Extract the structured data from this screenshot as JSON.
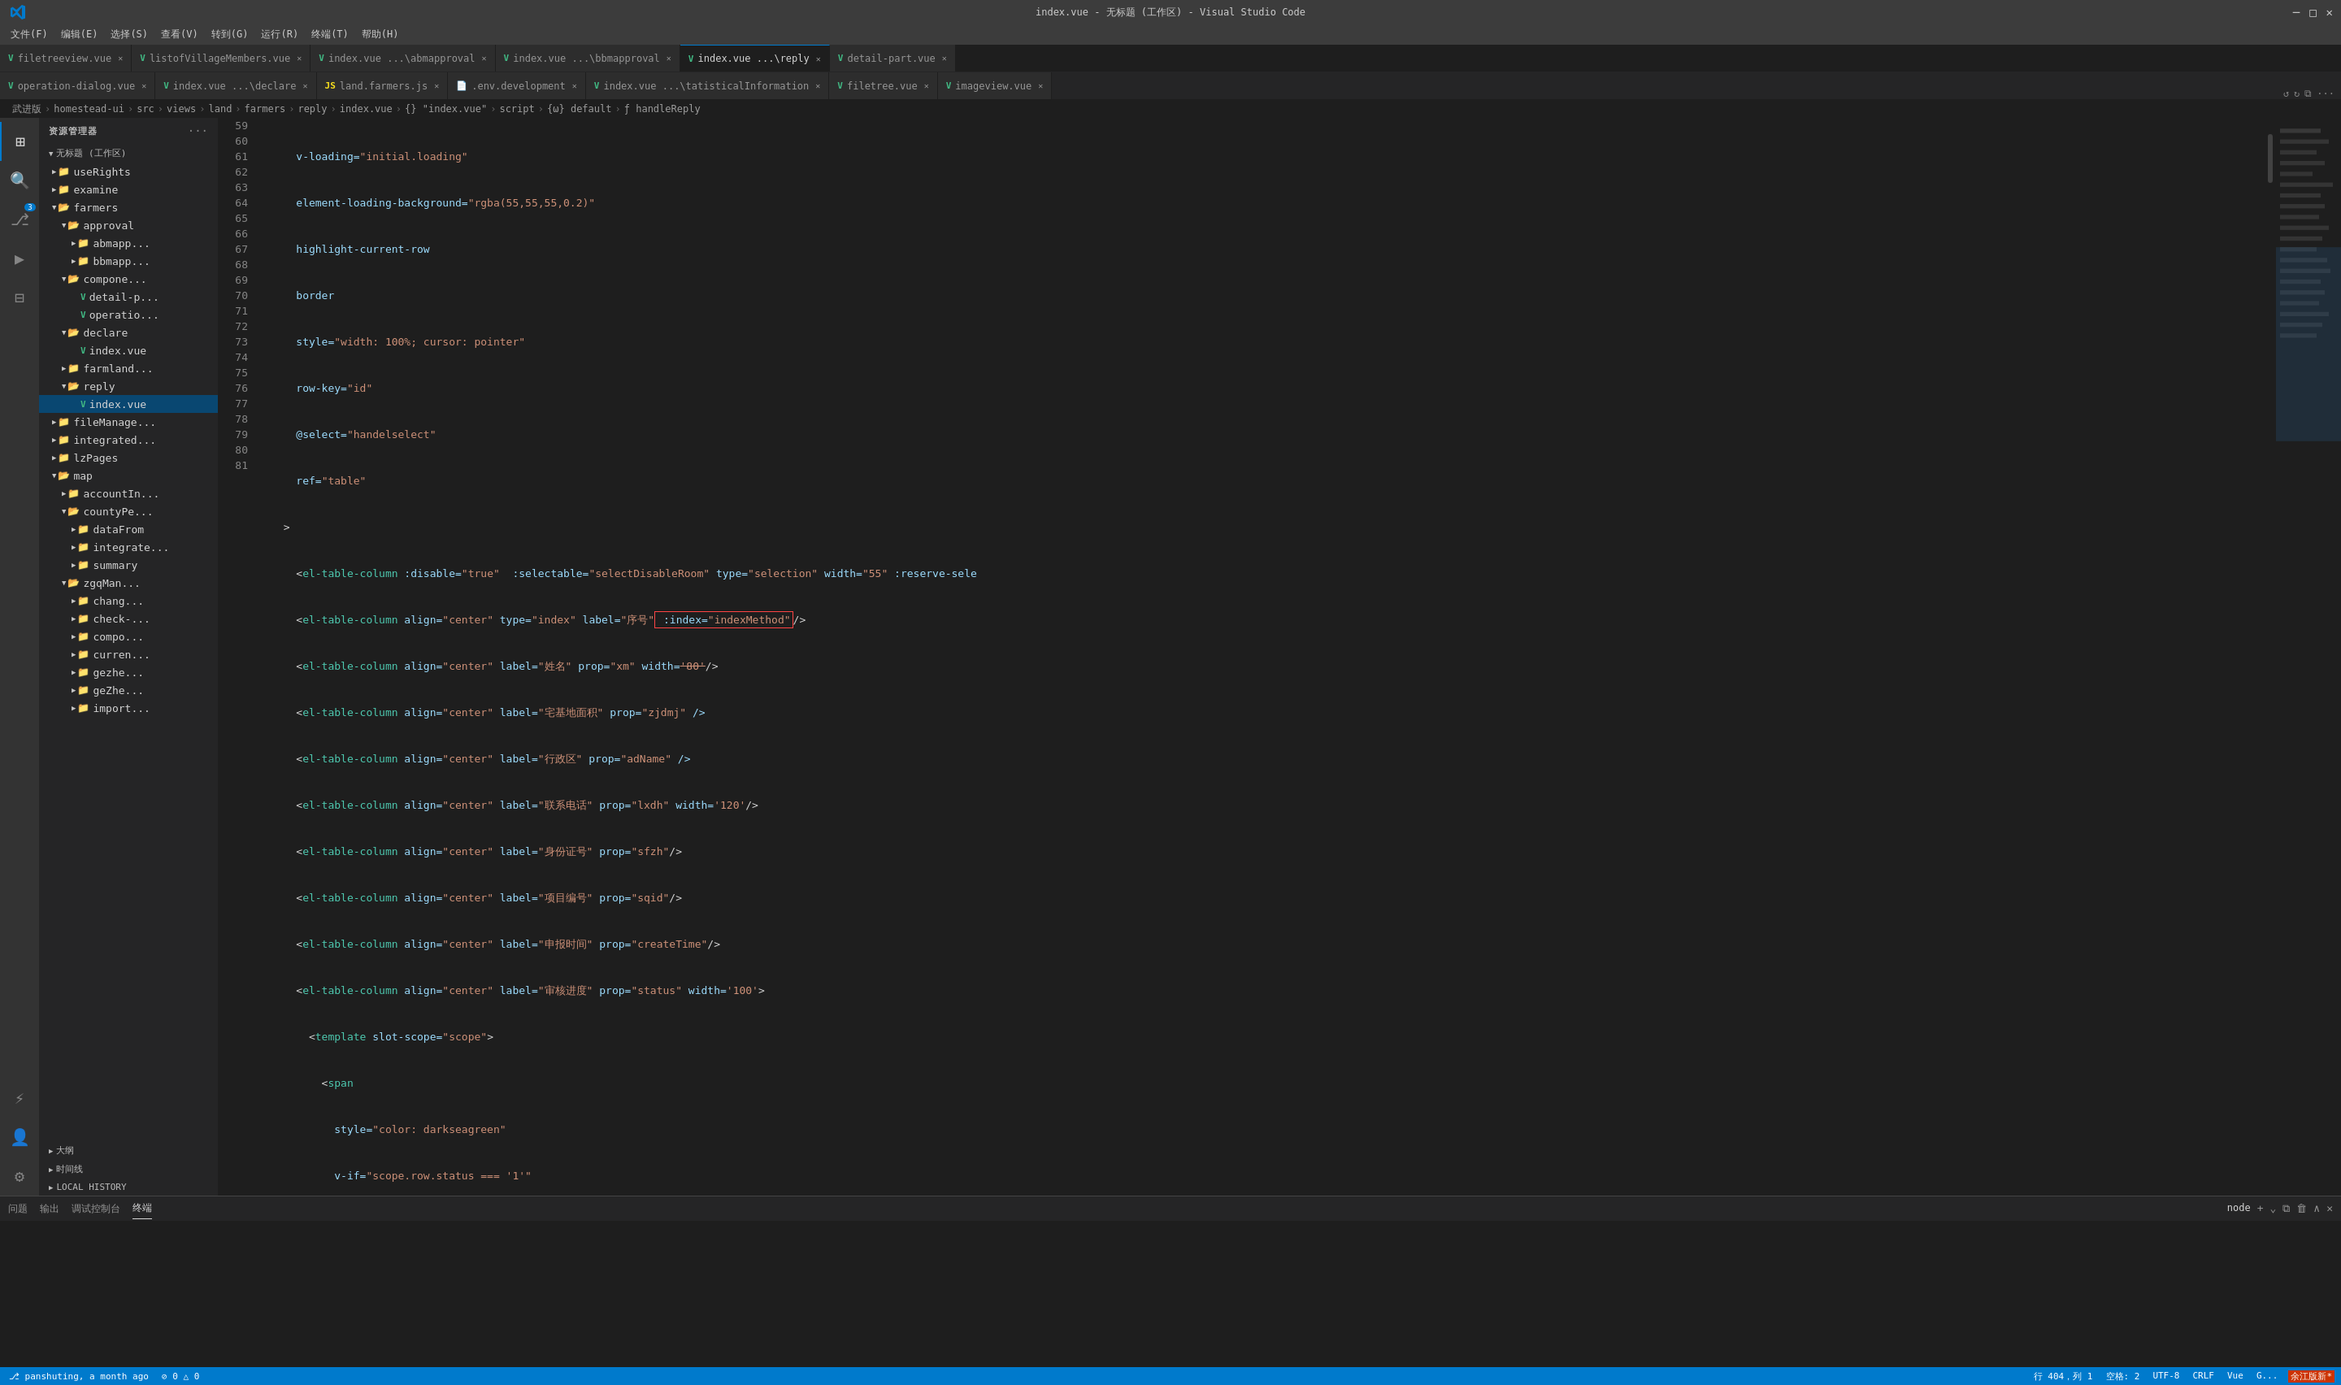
{
  "window": {
    "title": "index.vue - 无标题 (工作区) - Visual Studio Code"
  },
  "titlebar": {
    "menus": [
      "文件(F)",
      "编辑(E)",
      "选择(S)",
      "查看(V)",
      "转到(G)",
      "运行(R)",
      "终端(T)",
      "帮助(H)"
    ],
    "title": "index.vue - 无标题 (工作区) - Visual Studio Code",
    "min": "🗕",
    "max": "🗖",
    "close": "✕"
  },
  "tabs_row1": [
    {
      "id": "t1",
      "icon": "vue",
      "label": "filetreeview.vue",
      "active": false,
      "modified": false
    },
    {
      "id": "t2",
      "icon": "vue",
      "label": "listofVillageMembers.vue",
      "active": false,
      "modified": false
    },
    {
      "id": "t3",
      "icon": "vue",
      "label": "index.vue ...\\abmapproval",
      "active": false,
      "modified": false
    },
    {
      "id": "t4",
      "icon": "vue",
      "label": "index.vue ...\\bbmapproval",
      "active": false,
      "modified": false
    },
    {
      "id": "t5",
      "icon": "vue",
      "label": "index.vue ...\\reply",
      "active": true,
      "modified": false
    },
    {
      "id": "t6",
      "icon": "vue",
      "label": "detail-part.vue",
      "active": false,
      "modified": false
    }
  ],
  "tabs_row2": [
    {
      "id": "t7",
      "icon": "vue",
      "label": "operation-dialog.vue",
      "active": false
    },
    {
      "id": "t8",
      "icon": "vue",
      "label": "index.vue ...\\declare",
      "active": false
    },
    {
      "id": "t9",
      "icon": "js",
      "label": "land.farmers.js",
      "active": false
    },
    {
      "id": "t10",
      "icon": "env",
      "label": ".env.development",
      "active": false
    },
    {
      "id": "t11",
      "icon": "vue",
      "label": "index.vue ...\\tatisticalInformation",
      "active": false
    },
    {
      "id": "t12",
      "icon": "vue",
      "label": "filetree.vue",
      "active": false
    },
    {
      "id": "t13",
      "icon": "vue",
      "label": "imageview.vue",
      "active": false
    }
  ],
  "breadcrumb": {
    "items": [
      "武进版",
      "homestead-ui",
      "src",
      "views",
      "land",
      "farmers",
      "reply",
      "index.vue",
      "{} \"index.vue\"",
      "script",
      "{ω} default",
      "ƒ handleReply"
    ]
  },
  "sidebar": {
    "header": "资源管理器",
    "workspace": "无标题 (工作区)",
    "tree": [
      {
        "level": 1,
        "type": "folder",
        "label": "useRights",
        "open": false
      },
      {
        "level": 1,
        "type": "folder",
        "label": "examine",
        "open": false
      },
      {
        "level": 1,
        "type": "folder",
        "label": "farmers",
        "open": true
      },
      {
        "level": 2,
        "type": "folder",
        "label": "approval",
        "open": true
      },
      {
        "level": 3,
        "type": "folder",
        "label": "abmapp...",
        "open": false
      },
      {
        "level": 3,
        "type": "folder",
        "label": "bbmapp...",
        "open": false
      },
      {
        "level": 2,
        "type": "folder",
        "label": "compone...",
        "open": true
      },
      {
        "level": 3,
        "type": "file-vue",
        "label": "detail-p..."
      },
      {
        "level": 3,
        "type": "file-vue",
        "label": "operatio..."
      },
      {
        "level": 2,
        "type": "folder",
        "label": "declare",
        "open": true
      },
      {
        "level": 3,
        "type": "file-vue",
        "label": "index.vue"
      },
      {
        "level": 2,
        "type": "folder",
        "label": "farmland...",
        "open": false
      },
      {
        "level": 2,
        "type": "folder",
        "label": "reply",
        "open": true
      },
      {
        "level": 3,
        "type": "file-vue",
        "label": "index.vue",
        "active": true
      },
      {
        "level": 1,
        "type": "folder",
        "label": "fileManage...",
        "open": false
      },
      {
        "level": 1,
        "type": "folder",
        "label": "integrated...",
        "open": false
      },
      {
        "level": 1,
        "type": "folder",
        "label": "lzPages",
        "open": false
      },
      {
        "level": 1,
        "type": "folder",
        "label": "map",
        "open": true
      },
      {
        "level": 2,
        "type": "folder",
        "label": "accountIn...",
        "open": false
      },
      {
        "level": 2,
        "type": "folder",
        "label": "countyPe...",
        "open": true
      },
      {
        "level": 3,
        "type": "folder",
        "label": "dataFrom",
        "open": false
      },
      {
        "level": 3,
        "type": "folder",
        "label": "integrate...",
        "open": false
      },
      {
        "level": 3,
        "type": "folder",
        "label": "summary",
        "open": false
      },
      {
        "level": 2,
        "type": "folder",
        "label": "zgqMan...",
        "open": true
      },
      {
        "level": 3,
        "type": "folder",
        "label": "chang...",
        "open": false
      },
      {
        "level": 3,
        "type": "folder",
        "label": "check-...",
        "open": false
      },
      {
        "level": 3,
        "type": "folder",
        "label": "compo...",
        "open": false
      },
      {
        "level": 3,
        "type": "folder",
        "label": "curren...",
        "open": false
      },
      {
        "level": 3,
        "type": "folder",
        "label": "gezhe...",
        "open": false
      },
      {
        "level": 3,
        "type": "folder",
        "label": "geZhe...",
        "open": false
      },
      {
        "level": 3,
        "type": "folder",
        "label": "import...",
        "open": false
      }
    ],
    "sections": [
      {
        "label": "大纲",
        "open": false
      },
      {
        "label": "时间线",
        "open": false
      },
      {
        "label": "LOCAL HISTORY",
        "open": false
      }
    ]
  },
  "code": {
    "lines": [
      {
        "num": 59,
        "content": "    v-loading=\"initial.loading\""
      },
      {
        "num": 60,
        "content": "    element-loading-background=\"rgba(55,55,55,0.2)\""
      },
      {
        "num": 61,
        "content": "    highlight-current-row"
      },
      {
        "num": 62,
        "content": "    border"
      },
      {
        "num": 63,
        "content": "    style=\"width: 100%; cursor: pointer\""
      },
      {
        "num": 64,
        "content": "    row-key=\"id\""
      },
      {
        "num": 65,
        "content": "    @select=\"handelselect\""
      },
      {
        "num": 66,
        "content": "    ref=\"table\""
      },
      {
        "num": 67,
        "content": "  >"
      },
      {
        "num": 68,
        "content": "    <el-table-column :disable=\"true\"  :selectable=\"selectDisableRoom\" type=\"selection\" width=\"55\" :reserve-sele"
      },
      {
        "num": 69,
        "content": "    <el-table-column align=\"center\" type=\"index\" label=\"序号\" :index=\"indexMethod\"/>",
        "redbox": true
      },
      {
        "num": 70,
        "content": "    <el-table-column align=\"center\" label=\"姓名\" prop=\"xm\" width='80'/>"
      },
      {
        "num": 71,
        "content": "    <el-table-column align=\"center\" label=\"宅基地面积\" prop=\"zjdmj\" />"
      },
      {
        "num": 72,
        "content": "    <el-table-column align=\"center\" label=\"行政区\" prop=\"adName\" />"
      },
      {
        "num": 73,
        "content": "    <el-table-column align=\"center\" label=\"联系电话\" prop=\"lxdh\" width='120'/>"
      },
      {
        "num": 74,
        "content": "    <el-table-column align=\"center\" label=\"身份证号\" prop=\"sfzh\"/>"
      },
      {
        "num": 75,
        "content": "    <el-table-column align=\"center\" label=\"项目编号\" prop=\"sqid\"/>"
      },
      {
        "num": 76,
        "content": "    <el-table-column align=\"center\" label=\"申报时间\" prop=\"createTime\"/>"
      },
      {
        "num": 77,
        "content": "    <el-table-column align=\"center\" label=\"审核进度\" prop=\"status\" width='100'>"
      },
      {
        "num": 78,
        "content": "      <template slot-scope=\"scope\">"
      },
      {
        "num": 79,
        "content": "        <span"
      },
      {
        "num": 80,
        "content": "          style=\"color: darkseagreen\""
      },
      {
        "num": 81,
        "content": "          v-if=\"scope.row.status === '1'\""
      }
    ]
  },
  "panel": {
    "tabs": [
      "问题",
      "输出",
      "调试控制台",
      "终端"
    ],
    "active_tab": "终端",
    "terminal_content": ""
  },
  "statusbar": {
    "left": [
      "⎇ panshuting, a month ago"
    ],
    "right": [
      "行 404，列 1",
      "空格: 2",
      "UTF-8",
      "CRLF",
      "Vue",
      "G..."
    ]
  },
  "activity": {
    "icons": [
      {
        "name": "explorer",
        "symbol": "⊞",
        "active": true
      },
      {
        "name": "search",
        "symbol": "🔍",
        "active": false
      },
      {
        "name": "source-control",
        "symbol": "⎇",
        "active": false,
        "badge": "3"
      },
      {
        "name": "run-debug",
        "symbol": "▶",
        "active": false
      },
      {
        "name": "extensions",
        "symbol": "⊟",
        "active": false
      },
      {
        "name": "remote",
        "symbol": "⚡",
        "active": false
      },
      {
        "name": "account",
        "symbol": "👤",
        "active": false
      },
      {
        "name": "settings",
        "symbol": "⚙",
        "active": false
      }
    ]
  }
}
